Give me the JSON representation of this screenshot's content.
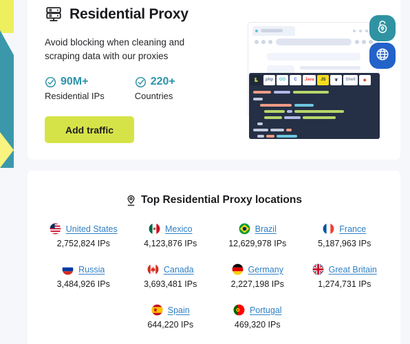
{
  "colors": {
    "accent_teal": "#2c93a8",
    "link_blue": "#2e7fc4",
    "button_green": "#d6e348",
    "deco_yellow": "#edef5f",
    "deco_teal": "#3b98ab",
    "badge_blue": "#2362c9",
    "page_bg": "#f5f7fa"
  },
  "product": {
    "icon": "server-rack-icon",
    "title": "Residential Proxy",
    "description": "Avoid blocking when cleaning and scraping data with our proxies",
    "stats": [
      {
        "icon": "check-circle-icon",
        "value": "90M+",
        "label": "Residential IPs"
      },
      {
        "icon": "check-circle-icon",
        "value": "220+",
        "label": "Countries"
      }
    ],
    "cta_label": "Add traffic"
  },
  "illustration": {
    "lock_badge_icon": "padlock-icon",
    "globe_badge_icon": "globe-icon",
    "code_tabs": [
      {
        "name": "python-tab",
        "label": "🐍",
        "active": true
      },
      {
        "name": "php-tab",
        "label": "php",
        "active": false
      },
      {
        "name": "go-tab",
        "label": "GO",
        "active": false
      },
      {
        "name": "csharp-tab",
        "label": "C",
        "active": false
      },
      {
        "name": "java-tab",
        "label": "Java",
        "active": false
      },
      {
        "name": "javascript-tab",
        "label": "JS",
        "active": false
      },
      {
        "name": "scrapy-tab",
        "label": "❦",
        "active": false
      },
      {
        "name": "shell-tab",
        "label": "Shell",
        "active": false
      },
      {
        "name": "ruby-tab",
        "label": "◆",
        "active": false
      }
    ]
  },
  "locations": {
    "icon": "map-pin-icon",
    "title": "Top Residential Proxy locations",
    "items": [
      {
        "flag": "flag-united-states",
        "name": "United States",
        "ips": "2,752,824 IPs"
      },
      {
        "flag": "flag-mexico",
        "name": "Mexico",
        "ips": "4,123,876 IPs"
      },
      {
        "flag": "flag-brazil",
        "name": "Brazil",
        "ips": "12,629,978 IPs"
      },
      {
        "flag": "flag-france",
        "name": "France",
        "ips": "5,187,963 IPs"
      },
      {
        "flag": "flag-russia",
        "name": "Russia",
        "ips": "3,484,926 IPs"
      },
      {
        "flag": "flag-canada",
        "name": "Canada",
        "ips": "3,693,481 IPs"
      },
      {
        "flag": "flag-germany",
        "name": "Germany",
        "ips": "2,227,198 IPs"
      },
      {
        "flag": "flag-great-britain",
        "name": "Great Britain",
        "ips": "1,274,731 IPs"
      },
      {
        "flag": "flag-spain",
        "name": "Spain",
        "ips": "644,220 IPs"
      },
      {
        "flag": "flag-portugal",
        "name": "Portugal",
        "ips": "469,320 IPs"
      }
    ]
  }
}
